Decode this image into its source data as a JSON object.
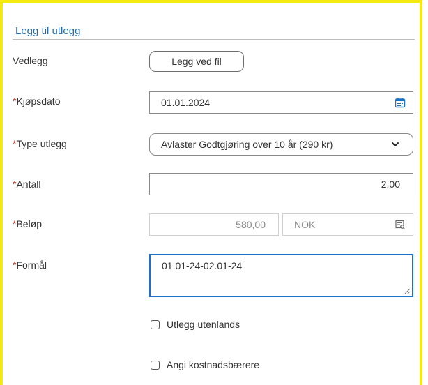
{
  "form": {
    "title": "Legg til utlegg",
    "required_marker": "*",
    "attachment": {
      "label": "Vedlegg",
      "button_label": "Legg ved fil"
    },
    "purchase_date": {
      "label": "Kjøpsdato",
      "value": "01.01.2024"
    },
    "expense_type": {
      "label": "Type utlegg",
      "selected": "Avlaster Godtgjøring over 10 år (290 kr)"
    },
    "quantity": {
      "label": "Antall",
      "value": "2,00"
    },
    "amount": {
      "label": "Beløp",
      "value": "580,00",
      "currency": "NOK"
    },
    "purpose": {
      "label": "Formål",
      "value": "01.01-24-02.01-24"
    },
    "abroad_checkbox": {
      "label": "Utlegg utenlands",
      "checked": false
    },
    "cost_carriers_checkbox": {
      "label": "Angi kostnadsbærere",
      "checked": false
    }
  },
  "colors": {
    "frame": "#f5e90f",
    "title": "#1f6fae",
    "required": "#c0392b",
    "focus": "#1a73c8",
    "calendar_icon": "#1a73c8"
  },
  "icons": {
    "calendar": "calendar-icon",
    "chevron": "chevron-down-icon",
    "lookup": "lookup-search-icon"
  }
}
